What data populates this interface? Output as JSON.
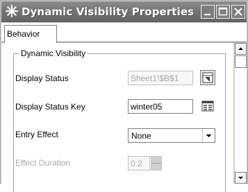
{
  "window": {
    "title": "Dynamic Visibility Properties"
  },
  "tabs": [
    {
      "label": "Behavior",
      "active": true
    }
  ],
  "group": {
    "label": "Dynamic Visibility"
  },
  "fields": {
    "display_status": {
      "label": "Display Status",
      "value": "Sheet1!$B$1",
      "enabled": false
    },
    "display_status_key": {
      "label": "Display Status Key",
      "value": "winter05",
      "enabled": true
    },
    "entry_effect": {
      "label": "Entry Effect",
      "value": "None",
      "enabled": true
    },
    "effect_duration": {
      "label": "Effect Duration",
      "value": "0.2",
      "enabled": false
    }
  },
  "icons": {
    "title": "asterisk-icon",
    "cell_picker": "cell-selector-icon",
    "key_picker": "list-selector-icon"
  }
}
